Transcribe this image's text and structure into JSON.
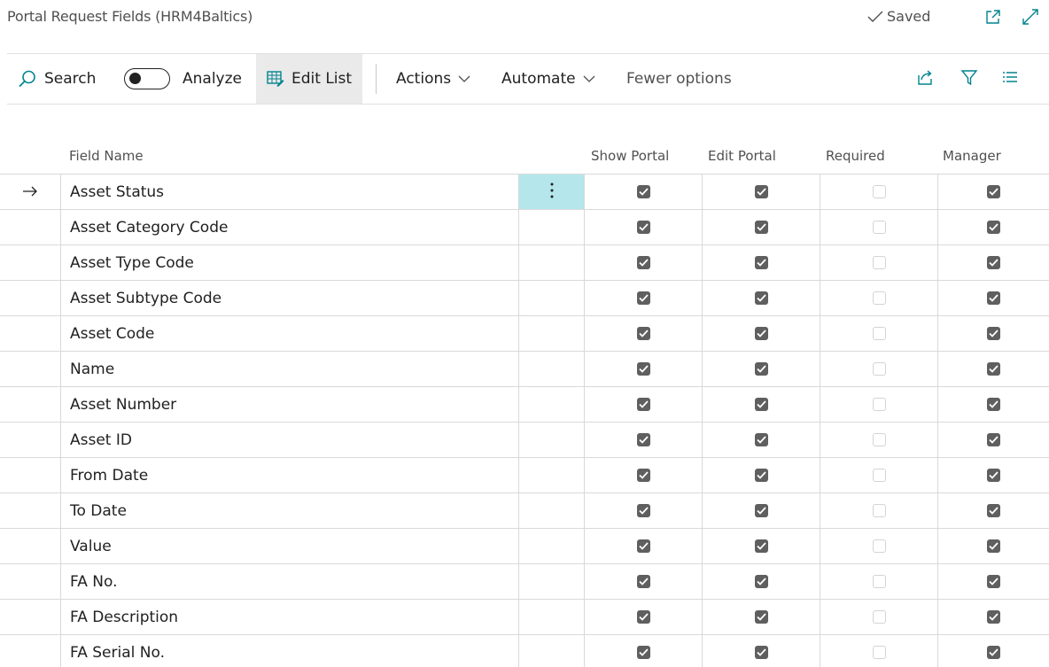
{
  "header": {
    "title": "Portal Request Fields (HRM4Baltics)",
    "saved_label": "Saved"
  },
  "actionbar": {
    "search_label": "Search",
    "analyze_label": "Analyze",
    "edit_list_label": "Edit List",
    "actions_label": "Actions",
    "automate_label": "Automate",
    "fewer_options_label": "Fewer options"
  },
  "table": {
    "columns": {
      "field_name": "Field Name",
      "show_portal": "Show Portal",
      "edit_portal": "Edit Portal",
      "required": "Required",
      "manager": "Manager"
    },
    "rows": [
      {
        "name": "Asset Status",
        "show_portal": true,
        "edit_portal": true,
        "required": false,
        "manager": true
      },
      {
        "name": "Asset Category Code",
        "show_portal": true,
        "edit_portal": true,
        "required": false,
        "manager": true
      },
      {
        "name": "Asset Type Code",
        "show_portal": true,
        "edit_portal": true,
        "required": false,
        "manager": true
      },
      {
        "name": "Asset Subtype Code",
        "show_portal": true,
        "edit_portal": true,
        "required": false,
        "manager": true
      },
      {
        "name": "Asset Code",
        "show_portal": true,
        "edit_portal": true,
        "required": false,
        "manager": true
      },
      {
        "name": "Name",
        "show_portal": true,
        "edit_portal": true,
        "required": false,
        "manager": true
      },
      {
        "name": "Asset Number",
        "show_portal": true,
        "edit_portal": true,
        "required": false,
        "manager": true
      },
      {
        "name": "Asset ID",
        "show_portal": true,
        "edit_portal": true,
        "required": false,
        "manager": true
      },
      {
        "name": "From Date",
        "show_portal": true,
        "edit_portal": true,
        "required": false,
        "manager": true
      },
      {
        "name": "To Date",
        "show_portal": true,
        "edit_portal": true,
        "required": false,
        "manager": true
      },
      {
        "name": "Value",
        "show_portal": true,
        "edit_portal": true,
        "required": false,
        "manager": true
      },
      {
        "name": "FA No.",
        "show_portal": true,
        "edit_portal": true,
        "required": false,
        "manager": true
      },
      {
        "name": "FA Description",
        "show_portal": true,
        "edit_portal": true,
        "required": false,
        "manager": true
      },
      {
        "name": "FA Serial No.",
        "show_portal": true,
        "edit_portal": true,
        "required": false,
        "manager": true
      }
    ]
  },
  "colors": {
    "accent": "#00838f",
    "active_cell": "#b4e6eb",
    "checkbox_on": "#5f5f5f"
  }
}
